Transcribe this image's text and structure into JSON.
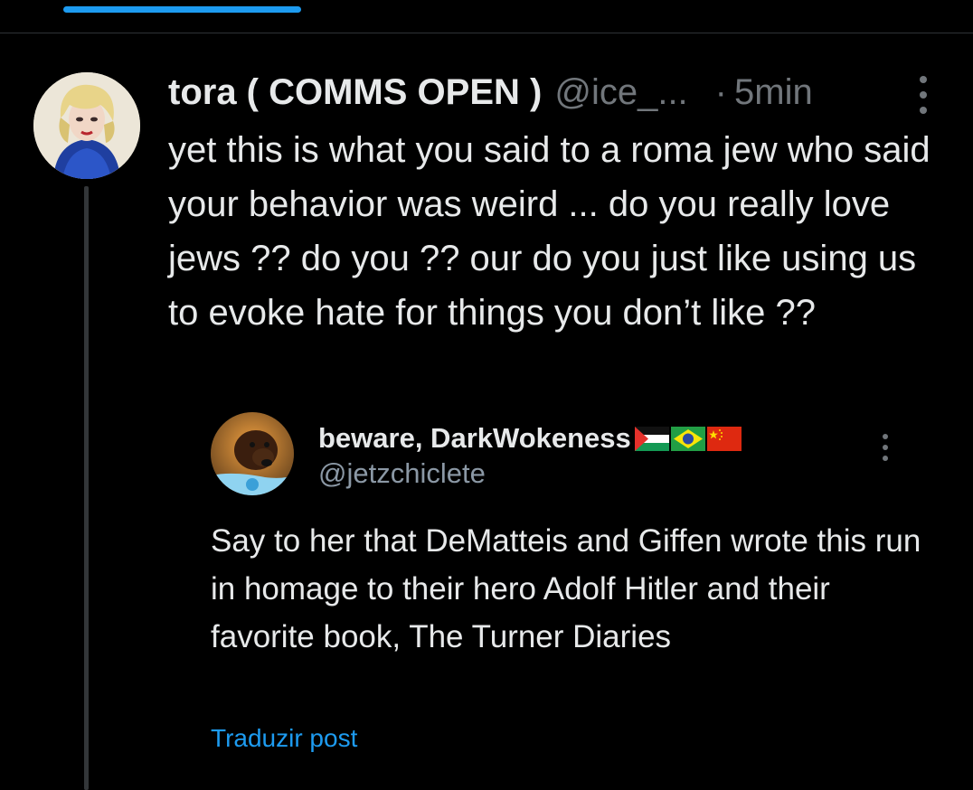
{
  "progress": {
    "fraction": 0.25
  },
  "tweet": {
    "display_name": "tora ( COMMS OPEN )",
    "handle": "@ice_...",
    "separator": "·",
    "time": "5min",
    "text": "yet this is what you said to a roma jew who said your behavior was weird ... do you really love jews ?? do you ?? our do you just like using us to evoke hate for things you don’t like ??"
  },
  "quoted_post": {
    "display_name": "beware, DarkWokeness",
    "flags": [
      "palestine-flag",
      "brazil-flag",
      "china-flag"
    ],
    "handle": "@jetzchiclete",
    "text": "Say to her that DeMatteis and Giffen wrote this run in homage to their hero Adolf Hitler and their favorite book, The Turner Diaries",
    "translate_label": "Traduzir post"
  },
  "colors": {
    "background": "#000000",
    "text_primary": "#e7e9ea",
    "text_secondary": "#71767b",
    "accent": "#1d9bf0",
    "divider": "#2f3336"
  },
  "icons": {
    "more": "more-options-icon"
  }
}
